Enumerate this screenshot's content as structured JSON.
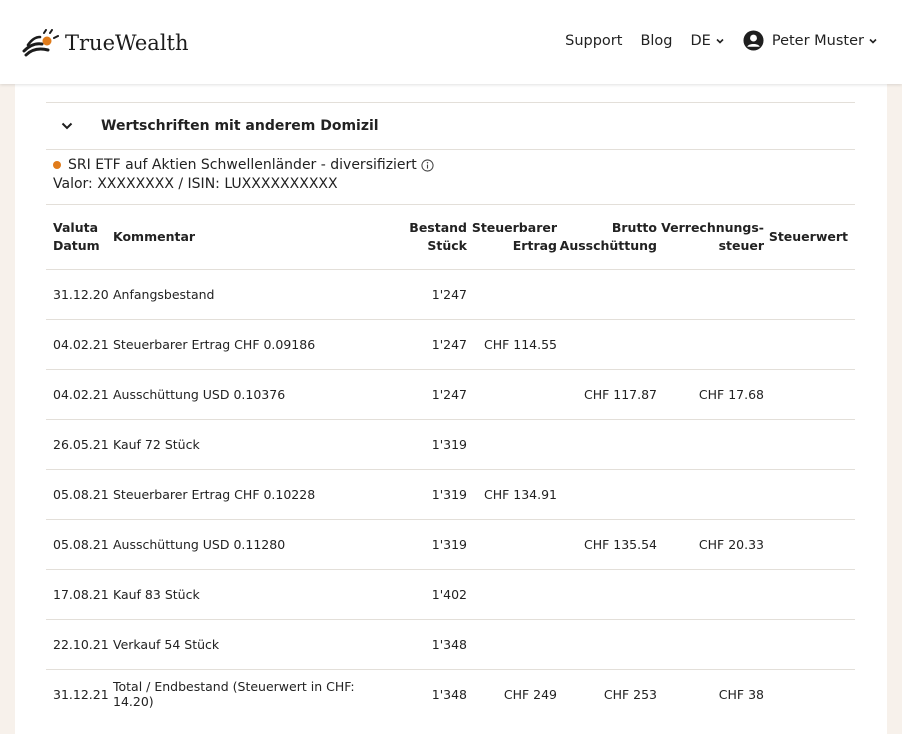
{
  "header": {
    "brand": "TrueWealth",
    "nav": {
      "support": "Support",
      "blog": "Blog",
      "language": "DE",
      "user": "Peter Muster"
    }
  },
  "section": {
    "title": "Wertschriften mit anderem Domizil",
    "security": {
      "name": "SRI ETF auf Aktien Schwellenländer - diversifiziert",
      "ids": "Valor: XXXXXXXX / ISIN: LUXXXXXXXXXX",
      "dot_color": "#e07b1a"
    }
  },
  "table": {
    "headers": {
      "date_1": "Valuta",
      "date_2": "Datum",
      "comment": "Kommentar",
      "qty_1": "Bestand",
      "qty_2": "Stück",
      "taxable_1": "Steuerbarer",
      "taxable_2": "Ertrag",
      "gross_1": "Brutto",
      "gross_2": "Ausschüttung",
      "wht_1": "Verrechnungs-",
      "wht_2": "steuer",
      "taxvalue": "Steuerwert"
    },
    "rows": [
      {
        "date": "31.12.20",
        "comment": "Anfangsbestand",
        "qty": "1'247",
        "taxable": "",
        "gross": "",
        "wht": "",
        "taxvalue": ""
      },
      {
        "date": "04.02.21",
        "comment": "Steuerbarer Ertrag CHF 0.09186",
        "qty": "1'247",
        "taxable": "CHF 114.55",
        "gross": "",
        "wht": "",
        "taxvalue": ""
      },
      {
        "date": "04.02.21",
        "comment": "Ausschüttung USD 0.10376",
        "qty": "1'247",
        "taxable": "",
        "gross": "CHF 117.87",
        "wht": "CHF 17.68",
        "taxvalue": ""
      },
      {
        "date": "26.05.21",
        "comment": "Kauf 72 Stück",
        "qty": "1'319",
        "taxable": "",
        "gross": "",
        "wht": "",
        "taxvalue": ""
      },
      {
        "date": "05.08.21",
        "comment": "Steuerbarer Ertrag CHF 0.10228",
        "qty": "1'319",
        "taxable": "CHF 134.91",
        "gross": "",
        "wht": "",
        "taxvalue": ""
      },
      {
        "date": "05.08.21",
        "comment": "Ausschüttung USD 0.11280",
        "qty": "1'319",
        "taxable": "",
        "gross": "CHF 135.54",
        "wht": "CHF 20.33",
        "taxvalue": ""
      },
      {
        "date": "17.08.21",
        "comment": "Kauf 83 Stück",
        "qty": "1'402",
        "taxable": "",
        "gross": "",
        "wht": "",
        "taxvalue": ""
      },
      {
        "date": "22.10.21",
        "comment": "Verkauf 54 Stück",
        "qty": "1'348",
        "taxable": "",
        "gross": "",
        "wht": "",
        "taxvalue": ""
      },
      {
        "date": "31.12.21",
        "comment": "Total / Endbestand (Steuerwert in CHF: 14.20)",
        "qty": "1'348",
        "taxable": "CHF 249",
        "gross": "CHF 253",
        "wht": "CHF 38",
        "taxvalue": ""
      }
    ]
  }
}
